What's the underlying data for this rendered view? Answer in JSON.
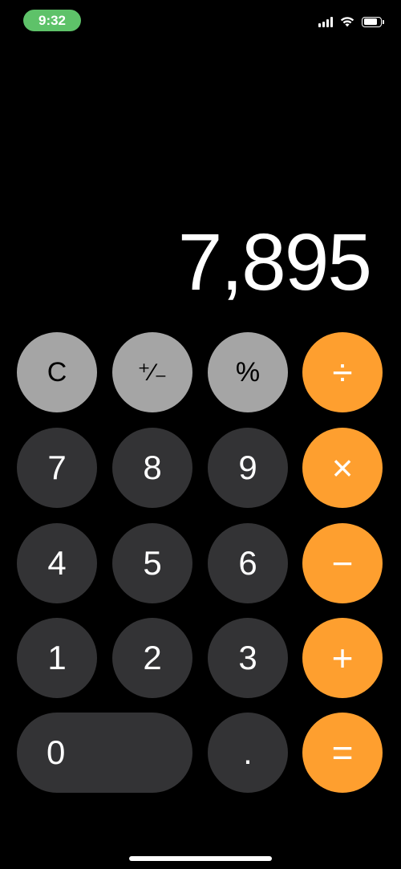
{
  "status_bar": {
    "time": "9:32",
    "battery_level": 0.85,
    "signal_bars": 4,
    "icons": [
      "signal-icon",
      "wifi-icon",
      "battery-icon"
    ]
  },
  "display": {
    "value": "7,895"
  },
  "keys": {
    "clear": "C",
    "sign": "⁺∕₋",
    "percent": "%",
    "divide": "÷",
    "seven": "7",
    "eight": "8",
    "nine": "9",
    "multiply": "×",
    "four": "4",
    "five": "5",
    "six": "6",
    "minus": "−",
    "one": "1",
    "two": "2",
    "three": "3",
    "plus": "+",
    "zero": "0",
    "decimal": ".",
    "equals": "="
  },
  "colors": {
    "background": "#000000",
    "digit_key": "#333335",
    "function_key": "#a5a5a5",
    "operator_key": "#fe9f2f",
    "time_pill": "#5ec269"
  }
}
